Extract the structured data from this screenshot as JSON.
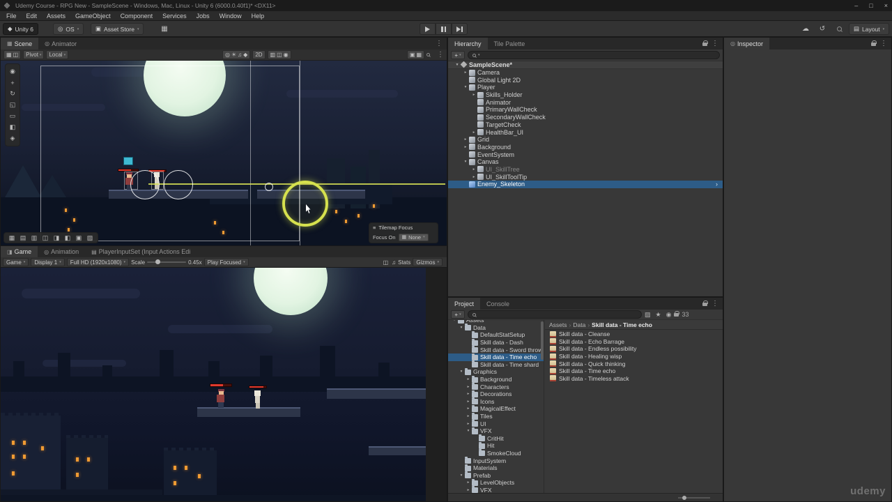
{
  "colors": {
    "selection_blue": "#2D5C87",
    "health_red": "#E03A2E",
    "gizmo_yellow": "#D6E14E",
    "prefab_blue": "#7BA4E0",
    "moon": "#E2F4E2",
    "window_orange": "#EF9B33"
  },
  "icons": {
    "unity": "◆",
    "circle": "◎",
    "bag": "▣",
    "dropdown_arrow": "▾",
    "grid": "▦",
    "cloud": "☁",
    "history": "↺",
    "layers": "▤",
    "kebab": "⋮",
    "plus": "+",
    "crumb_sep": "›",
    "drag": "≡"
  },
  "title_bar": {
    "title": "Udemy Course - RPG New - SampleScene - Windows, Mac, Linux - Unity 6 (6000.0.40f1)* <DX11>",
    "buttons": {
      "minimize": "–",
      "maximize": "□",
      "close": "×"
    }
  },
  "menu_bar": {
    "items": [
      "File",
      "Edit",
      "Assets",
      "GameObject",
      "Component",
      "Services",
      "Jobs",
      "Window",
      "Help"
    ]
  },
  "toolbar": {
    "unity_badge": "Unity 6",
    "os_label": "OS",
    "asset_store_label": "Asset Store",
    "layout_label": "Layout"
  },
  "scene_panel": {
    "tabs": [
      {
        "label": "Scene",
        "active": true,
        "glyph": "▦"
      },
      {
        "label": "Animator",
        "glyph": "◎"
      }
    ],
    "toolbar": {
      "left_icons": [
        "▦",
        "◫"
      ],
      "pivot": "Pivot",
      "local": "Local",
      "center_icons": [
        "◎",
        "☀",
        "♫",
        "◆"
      ],
      "two_d": "2D",
      "mid_icons": [
        "▥",
        "◫",
        "◉"
      ],
      "right_icons": [
        "▣",
        "▦"
      ]
    },
    "tools": [
      "◉",
      "+",
      "↻",
      "◱",
      "▭",
      "◧",
      "◈"
    ],
    "tile_tools": [
      "▦",
      "▤",
      "▥",
      "◫",
      "◨",
      "◧",
      "▣",
      "▨"
    ],
    "tilemap_focus": {
      "title": "Tilemap Focus",
      "focus_on_label": "Focus On",
      "value": "None"
    }
  },
  "game_panel": {
    "tabs": [
      {
        "label": "Game",
        "active": true,
        "glyph": "◨"
      },
      {
        "label": "Animation",
        "glyph": "◎"
      },
      {
        "label": "PlayerInputSet (Input Actions Edi",
        "glyph": "▤"
      }
    ],
    "toolbar": {
      "mode": "Game",
      "display": "Display 1",
      "resolution": "Full HD (1920x1080)",
      "scale_label": "Scale",
      "scale_value": "0.45x",
      "play_focused": "Play Focused",
      "right_icons": [
        "◫",
        "♫"
      ],
      "stats_label": "Stats",
      "gizmos_label": "Gizmos"
    }
  },
  "hierarchy_panel": {
    "tabs": [
      {
        "label": "Hierarchy",
        "active": true
      },
      {
        "label": "Tile Palette"
      }
    ],
    "items": [
      {
        "label": "SampleScene*",
        "indent": 0,
        "icon": "scene",
        "arrow": "down",
        "header": true
      },
      {
        "label": "Camera",
        "indent": 1,
        "arrow": "right"
      },
      {
        "label": "Global Light 2D",
        "indent": 1
      },
      {
        "label": "Player",
        "indent": 1,
        "arrow": "down"
      },
      {
        "label": "Skills_Holder",
        "indent": 2,
        "arrow": "right"
      },
      {
        "label": "Animator",
        "indent": 2
      },
      {
        "label": "PrimaryWallCheck",
        "indent": 2
      },
      {
        "label": "SecondaryWallCheck",
        "indent": 2
      },
      {
        "label": "TargetCheck",
        "indent": 2
      },
      {
        "label": "HealthBar_UI",
        "indent": 2,
        "arrow": "right"
      },
      {
        "label": "Grid",
        "indent": 1,
        "arrow": "right"
      },
      {
        "label": "Background",
        "indent": 1,
        "arrow": "right"
      },
      {
        "label": "EventSystem",
        "indent": 1
      },
      {
        "label": "Canvas",
        "indent": 1,
        "arrow": "down"
      },
      {
        "label": "UI_SkillTree",
        "indent": 2,
        "arrow": "right",
        "disabled": true
      },
      {
        "label": "UI_SkillToolTip",
        "indent": 2,
        "arrow": "right"
      },
      {
        "label": "Enemy_Skeleton",
        "indent": 1,
        "icon": "prefab",
        "selected": true,
        "chevron": true
      }
    ]
  },
  "project_panel": {
    "tabs": [
      {
        "label": "Project",
        "active": true
      },
      {
        "label": "Console"
      }
    ],
    "toolbar_icons": [
      "▨",
      "★",
      "◉"
    ],
    "badge_count": "33",
    "folders": [
      {
        "label": "Assets",
        "indent": 0,
        "arrow": "down",
        "clipped": true
      },
      {
        "label": "Data",
        "indent": 1,
        "arrow": "down"
      },
      {
        "label": "DefaultStatSetup",
        "indent": 2
      },
      {
        "label": "Skill data - Dash",
        "indent": 2
      },
      {
        "label": "Skill data - Sword throw",
        "indent": 2
      },
      {
        "label": "Skill data - Time echo",
        "indent": 2,
        "selected": true
      },
      {
        "label": "Skill data - Time shard",
        "indent": 2
      },
      {
        "label": "Graphics",
        "indent": 1,
        "arrow": "down"
      },
      {
        "label": "Background",
        "indent": 2,
        "arrow": "right"
      },
      {
        "label": "Characters",
        "indent": 2,
        "arrow": "right"
      },
      {
        "label": "Decorations",
        "indent": 2,
        "arrow": "right"
      },
      {
        "label": "Icons",
        "indent": 2,
        "arrow": "right"
      },
      {
        "label": "MagicalEffect",
        "indent": 2,
        "arrow": "right"
      },
      {
        "label": "Tiles",
        "indent": 2,
        "arrow": "right"
      },
      {
        "label": "UI",
        "indent": 2,
        "arrow": "right"
      },
      {
        "label": "VFX",
        "indent": 2,
        "arrow": "down"
      },
      {
        "label": "CritHit",
        "indent": 3
      },
      {
        "label": "Hit",
        "indent": 3
      },
      {
        "label": "SmokeCloud",
        "indent": 3
      },
      {
        "label": "InputSystem",
        "indent": 1
      },
      {
        "label": "Materials",
        "indent": 1
      },
      {
        "label": "Prefab",
        "indent": 1,
        "arrow": "down"
      },
      {
        "label": "LevelObjects",
        "indent": 2,
        "arrow": "right"
      },
      {
        "label": "VFX",
        "indent": 2,
        "arrow": "right"
      }
    ],
    "breadcrumb": [
      "Assets",
      "Data",
      "Skill data - Time echo"
    ],
    "files": [
      {
        "label": "Skill data - Cleanse"
      },
      {
        "label": "Skill data - Echo Barrage"
      },
      {
        "label": "Skill data - Endless possibility"
      },
      {
        "label": "Skill data - Healing wisp"
      },
      {
        "label": "Skill data - Quick thinking"
      },
      {
        "label": "Skill data - Time echo"
      },
      {
        "label": "Skill data - Timeless attack"
      }
    ]
  },
  "inspector_panel": {
    "tab": "Inspector"
  },
  "watermark": "udemy"
}
